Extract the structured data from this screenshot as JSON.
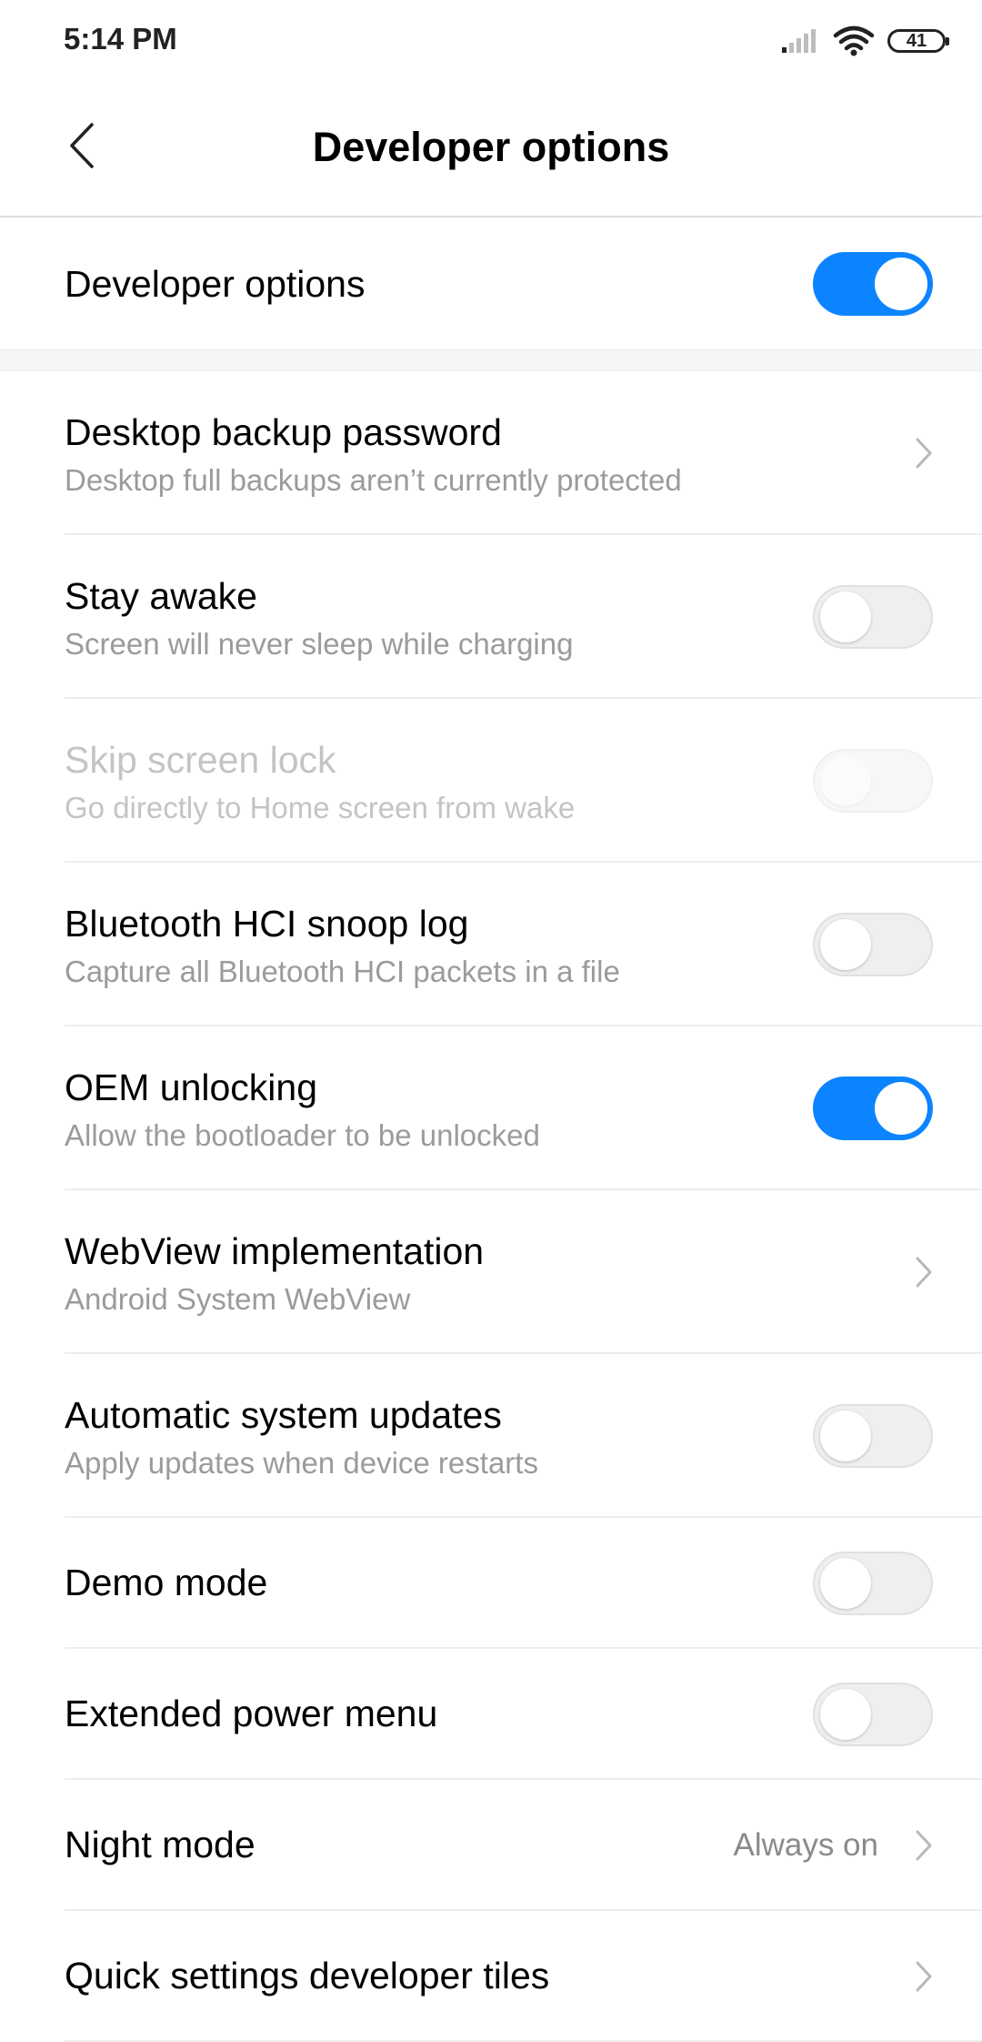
{
  "status_bar": {
    "time": "5:14 PM",
    "battery": "41"
  },
  "header": {
    "title": "Developer options"
  },
  "master": {
    "label": "Developer options",
    "enabled": true
  },
  "rows": [
    {
      "id": "desktop-backup-password",
      "title": "Desktop backup password",
      "subtitle": "Desktop full backups aren’t currently protected",
      "control": "chevron"
    },
    {
      "id": "stay-awake",
      "title": "Stay awake",
      "subtitle": "Screen will never sleep while charging",
      "control": "toggle",
      "state": "off"
    },
    {
      "id": "skip-screen-lock",
      "title": "Skip screen lock",
      "subtitle": "Go directly to Home screen from wake",
      "control": "toggle",
      "state": "off",
      "disabled": true
    },
    {
      "id": "bluetooth-hci-snoop-log",
      "title": "Bluetooth HCI snoop log",
      "subtitle": "Capture all Bluetooth HCI packets in a file",
      "control": "toggle",
      "state": "off"
    },
    {
      "id": "oem-unlocking",
      "title": "OEM unlocking",
      "subtitle": "Allow the bootloader to be unlocked",
      "control": "toggle",
      "state": "on"
    },
    {
      "id": "webview-implementation",
      "title": "WebView implementation",
      "subtitle": "Android System WebView",
      "control": "chevron"
    },
    {
      "id": "automatic-system-updates",
      "title": "Automatic system updates",
      "subtitle": "Apply updates when device restarts",
      "control": "toggle",
      "state": "off"
    },
    {
      "id": "demo-mode",
      "title": "Demo mode",
      "control": "toggle",
      "state": "off"
    },
    {
      "id": "extended-power-menu",
      "title": "Extended power menu",
      "control": "toggle",
      "state": "off"
    },
    {
      "id": "night-mode",
      "title": "Night mode",
      "value": "Always on",
      "control": "chevron"
    },
    {
      "id": "quick-settings-developer-tiles",
      "title": "Quick settings developer tiles",
      "control": "chevron"
    }
  ],
  "colors": {
    "accent": "#0d84ff",
    "subtitle": "#9b9b9b",
    "divider": "#ededed"
  },
  "icons": {
    "back": "chevron-left-icon",
    "chevron": "chevron-right-icon",
    "signal": "cellular-signal-icon",
    "wifi": "wifi-icon",
    "battery": "battery-icon"
  }
}
